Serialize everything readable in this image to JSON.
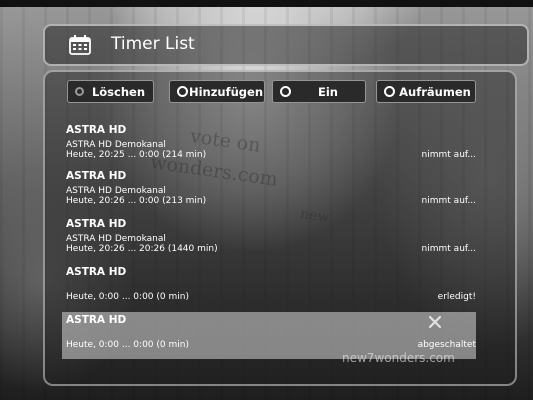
{
  "window": {
    "title": "Timer List",
    "title_icon": "calendar-icon"
  },
  "buttons": [
    {
      "label": "Löschen",
      "indicator": "grey-ring"
    },
    {
      "label": "Hinzufügen",
      "indicator": "white-ring"
    },
    {
      "label": "Ein",
      "indicator": "white-ring"
    },
    {
      "label": "Aufräumen",
      "indicator": "white-ring"
    }
  ],
  "timers": [
    {
      "channel": "ASTRA HD",
      "program": "ASTRA HD Demokanal",
      "time": "Heute, 20:25 ... 0:00 (214 min)",
      "status": "nimmt auf..."
    },
    {
      "channel": "ASTRA HD",
      "program": "ASTRA HD Demokanal",
      "time": "Heute, 20:26 ... 0:00 (213 min)",
      "status": "nimmt auf..."
    },
    {
      "channel": "ASTRA HD",
      "program": "ASTRA HD Demokanal",
      "time": "Heute, 20:26 ... 20:26 (1440 min)",
      "status": "nimmt auf..."
    },
    {
      "channel": "ASTRA HD",
      "program": "",
      "time": "Heute, 0:00 ... 0:00 (0 min)",
      "status": "erledigt!"
    },
    {
      "channel": "ASTRA HD",
      "program": "",
      "time": "Heute, 0:00 ... 0:00 (0 min)",
      "status": "abgeschaltet",
      "selected": true,
      "disabled_icon": "x-icon"
    }
  ],
  "watermark": "new7wonders.com",
  "background_text": [
    "vote on",
    "wonders.com",
    "new"
  ],
  "colors": {
    "selection": "#d7d7d7",
    "text": "#ffffff"
  }
}
